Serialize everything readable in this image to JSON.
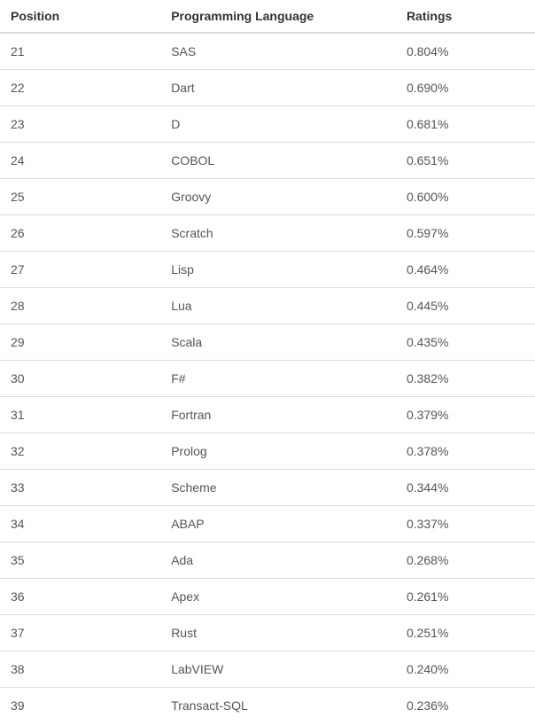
{
  "table": {
    "headers": {
      "position": "Position",
      "language": "Programming Language",
      "ratings": "Ratings"
    },
    "rows": [
      {
        "position": "21",
        "language": "SAS",
        "ratings": "0.804%"
      },
      {
        "position": "22",
        "language": "Dart",
        "ratings": "0.690%"
      },
      {
        "position": "23",
        "language": "D",
        "ratings": "0.681%"
      },
      {
        "position": "24",
        "language": "COBOL",
        "ratings": "0.651%"
      },
      {
        "position": "25",
        "language": "Groovy",
        "ratings": "0.600%"
      },
      {
        "position": "26",
        "language": "Scratch",
        "ratings": "0.597%"
      },
      {
        "position": "27",
        "language": "Lisp",
        "ratings": "0.464%"
      },
      {
        "position": "28",
        "language": "Lua",
        "ratings": "0.445%"
      },
      {
        "position": "29",
        "language": "Scala",
        "ratings": "0.435%"
      },
      {
        "position": "30",
        "language": "F#",
        "ratings": "0.382%"
      },
      {
        "position": "31",
        "language": "Fortran",
        "ratings": "0.379%"
      },
      {
        "position": "32",
        "language": "Prolog",
        "ratings": "0.378%"
      },
      {
        "position": "33",
        "language": "Scheme",
        "ratings": "0.344%"
      },
      {
        "position": "34",
        "language": "ABAP",
        "ratings": "0.337%"
      },
      {
        "position": "35",
        "language": "Ada",
        "ratings": "0.268%"
      },
      {
        "position": "36",
        "language": "Apex",
        "ratings": "0.261%"
      },
      {
        "position": "37",
        "language": "Rust",
        "ratings": "0.251%"
      },
      {
        "position": "38",
        "language": "LabVIEW",
        "ratings": "0.240%"
      },
      {
        "position": "39",
        "language": "Transact-SQL",
        "ratings": "0.236%"
      }
    ]
  }
}
